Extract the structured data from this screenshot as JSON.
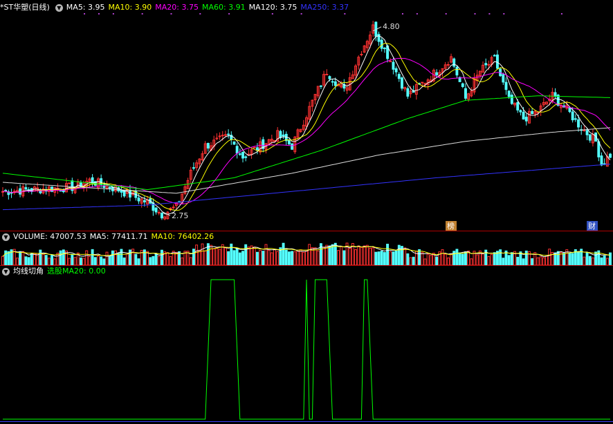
{
  "price_panel": {
    "title": "*ST华塑(日线)",
    "indicators": [
      {
        "label": "MA5: 3.95",
        "color": "#ffffff"
      },
      {
        "label": "MA10: 3.90",
        "color": "#ffff00"
      },
      {
        "label": "MA20: 3.75",
        "color": "#ff00ff"
      },
      {
        "label": "MA60: 3.91",
        "color": "#00ff00"
      },
      {
        "label": "MA120: 3.75",
        "color": "#ffffff"
      },
      {
        "label": "MA250: 3.37",
        "color": "#3333ff"
      }
    ],
    "high_label": "4.80",
    "low_label": "2.75",
    "badges": [
      "榜",
      "财"
    ]
  },
  "volume_panel": {
    "indicators": [
      {
        "label": "VOLUME: 47007.53",
        "color": "#ffffff"
      },
      {
        "label": "MA5: 77411.71",
        "color": "#ffffff"
      },
      {
        "label": "MA10: 76402.26",
        "color": "#ffff00"
      }
    ]
  },
  "signal_panel": {
    "title": "均线切角",
    "indicator_label": "选股MA20: 0.00",
    "indicator_color": "#00ff00"
  },
  "colors": {
    "up": "#ff3232",
    "down": "#54ffff",
    "ma5": "#ffffff",
    "ma10": "#ffff00",
    "ma20": "#ff00ff",
    "ma60": "#00ff00",
    "ma120": "#dddddd",
    "ma250": "#3333ff",
    "signal": "#00ff00",
    "divider": "#b00000"
  },
  "chart_data": [
    {
      "type": "candlestick",
      "title": "*ST华塑(日线)",
      "ylim": [
        2.6,
        4.95
      ],
      "price_high": 4.8,
      "price_low": 2.75,
      "keypoints": [
        [
          0,
          3.0
        ],
        [
          25,
          3.05
        ],
        [
          30,
          3.12
        ],
        [
          40,
          3.02
        ],
        [
          50,
          2.88
        ],
        [
          55,
          2.75
        ],
        [
          60,
          2.83
        ],
        [
          65,
          3.2
        ],
        [
          70,
          3.5
        ],
        [
          78,
          3.6
        ],
        [
          83,
          3.38
        ],
        [
          95,
          3.62
        ],
        [
          100,
          3.5
        ],
        [
          108,
          4.05
        ],
        [
          112,
          4.32
        ],
        [
          118,
          4.1
        ],
        [
          124,
          4.55
        ],
        [
          128,
          4.8
        ],
        [
          135,
          4.38
        ],
        [
          140,
          4.05
        ],
        [
          150,
          4.32
        ],
        [
          155,
          4.47
        ],
        [
          160,
          4.02
        ],
        [
          165,
          4.32
        ],
        [
          170,
          4.45
        ],
        [
          175,
          4.0
        ],
        [
          180,
          3.8
        ],
        [
          185,
          3.88
        ],
        [
          190,
          4.05
        ],
        [
          195,
          3.9
        ],
        [
          200,
          3.7
        ],
        [
          205,
          3.55
        ],
        [
          207,
          3.3
        ],
        [
          210,
          3.4
        ]
      ],
      "ma60_points": [
        [
          0,
          3.2
        ],
        [
          50,
          3.02
        ],
        [
          80,
          3.15
        ],
        [
          110,
          3.45
        ],
        [
          140,
          3.8
        ],
        [
          160,
          4.0
        ],
        [
          185,
          4.05
        ],
        [
          210,
          4.03
        ]
      ],
      "ma120_points": [
        [
          0,
          3.1
        ],
        [
          60,
          2.98
        ],
        [
          100,
          3.2
        ],
        [
          130,
          3.4
        ],
        [
          160,
          3.55
        ],
        [
          190,
          3.65
        ],
        [
          210,
          3.7
        ]
      ],
      "ma250_points": [
        [
          0,
          2.8
        ],
        [
          50,
          2.85
        ],
        [
          100,
          3.0
        ],
        [
          150,
          3.15
        ],
        [
          210,
          3.3
        ]
      ],
      "series": [
        {
          "name": "MA5",
          "value": 3.95
        },
        {
          "name": "MA10",
          "value": 3.9
        },
        {
          "name": "MA20",
          "value": 3.75
        },
        {
          "name": "MA60",
          "value": 3.91
        },
        {
          "name": "MA120",
          "value": 3.75
        },
        {
          "name": "MA250",
          "value": 3.37
        }
      ]
    },
    {
      "type": "bar",
      "title": "VOLUME",
      "series": [
        {
          "name": "VOLUME",
          "value": 47007.53
        },
        {
          "name": "MA5",
          "value": 77411.71
        },
        {
          "name": "MA10",
          "value": 76402.26
        }
      ]
    },
    {
      "type": "line",
      "title": "均线切角",
      "ylim": [
        0,
        1
      ],
      "series": [
        {
          "name": "选股MA20",
          "points": [
            [
              0,
              0
            ],
            [
              70,
              0
            ],
            [
              72,
              1
            ],
            [
              80,
              1
            ],
            [
              82,
              0
            ],
            [
              104,
              0
            ],
            [
              105,
              1
            ],
            [
              106,
              0
            ],
            [
              107,
              0
            ],
            [
              108,
              1
            ],
            [
              112,
              1
            ],
            [
              114,
              0
            ],
            [
              124,
              0
            ],
            [
              125,
              1
            ],
            [
              126,
              1
            ],
            [
              128,
              0
            ],
            [
              210,
              0
            ]
          ]
        }
      ]
    }
  ]
}
